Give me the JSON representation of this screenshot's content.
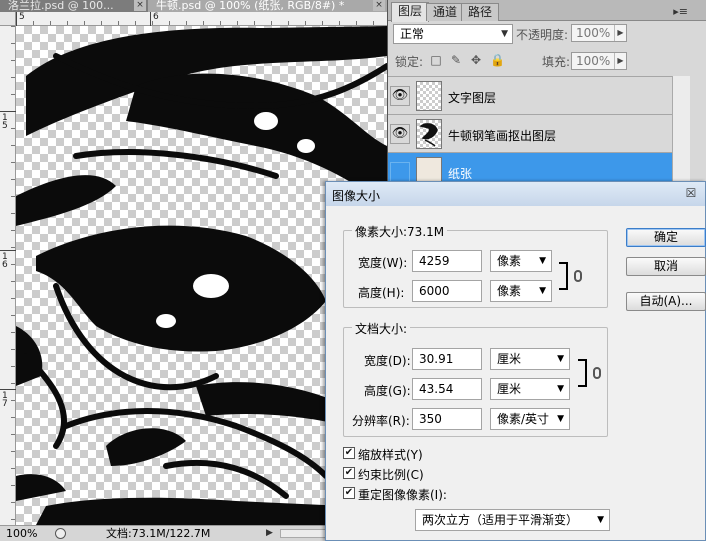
{
  "document_tabs": [
    {
      "label": "洛兰拉.psd @ 100...",
      "close": "×"
    },
    {
      "label": "牛顿.psd @ 100% (纸张, RGB/8#) *",
      "close": "×"
    }
  ],
  "ruler_top_labels": [
    "5",
    "6"
  ],
  "ruler_left_labels": [
    "1\n5",
    "1\n6",
    "1\n7"
  ],
  "status_bar": {
    "zoom": "100%",
    "document_info": "文档:73.1M/122.7M",
    "arrow": "▶"
  },
  "layers_panel": {
    "tabs": [
      "图层",
      "通道",
      "路径"
    ],
    "menu_icon": "▸≡",
    "blend_mode": "正常",
    "opacity_label": "不透明度:",
    "opacity_value": "100%",
    "lock_label": "锁定:",
    "lock_icons": [
      "□",
      "✎",
      "✥",
      "🔒"
    ],
    "fill_label": "填充:",
    "fill_value": "100%",
    "layers": [
      {
        "name": "文字图层",
        "visible": true,
        "eye": "👁",
        "selected": false
      },
      {
        "name": "牛顿钢笔画抠出图层",
        "visible": true,
        "eye": "👁",
        "selected": false
      },
      {
        "name": "纸张",
        "visible": false,
        "eye": "",
        "selected": true
      }
    ]
  },
  "dialog": {
    "title": "图像大小",
    "close": "☒",
    "pixel_dimensions": {
      "title": "像素大小:73.1M",
      "width_label": "宽度(W):",
      "width_value": "4259",
      "width_unit": "像素",
      "height_label": "高度(H):",
      "height_value": "6000",
      "height_unit": "像素"
    },
    "document_size": {
      "title": "文档大小:",
      "width_label": "宽度(D):",
      "width_value": "30.91",
      "width_unit": "厘米",
      "height_label": "高度(G):",
      "height_value": "43.54",
      "height_unit": "厘米",
      "resolution_label": "分辨率(R):",
      "resolution_value": "350",
      "resolution_unit": "像素/英寸"
    },
    "buttons": {
      "ok": "确定",
      "cancel": "取消",
      "auto": "自动(A)..."
    },
    "checkboxes": [
      {
        "label": "缩放样式(Y)",
        "checked": true,
        "mark": "✔"
      },
      {
        "label": "约束比例(C)",
        "checked": true,
        "mark": "✔"
      },
      {
        "label": "重定图像像素(I):",
        "checked": true,
        "mark": "✔"
      }
    ],
    "resample_method": "两次立方（适用于平滑渐变）",
    "dropdown_arrow": "▼"
  }
}
